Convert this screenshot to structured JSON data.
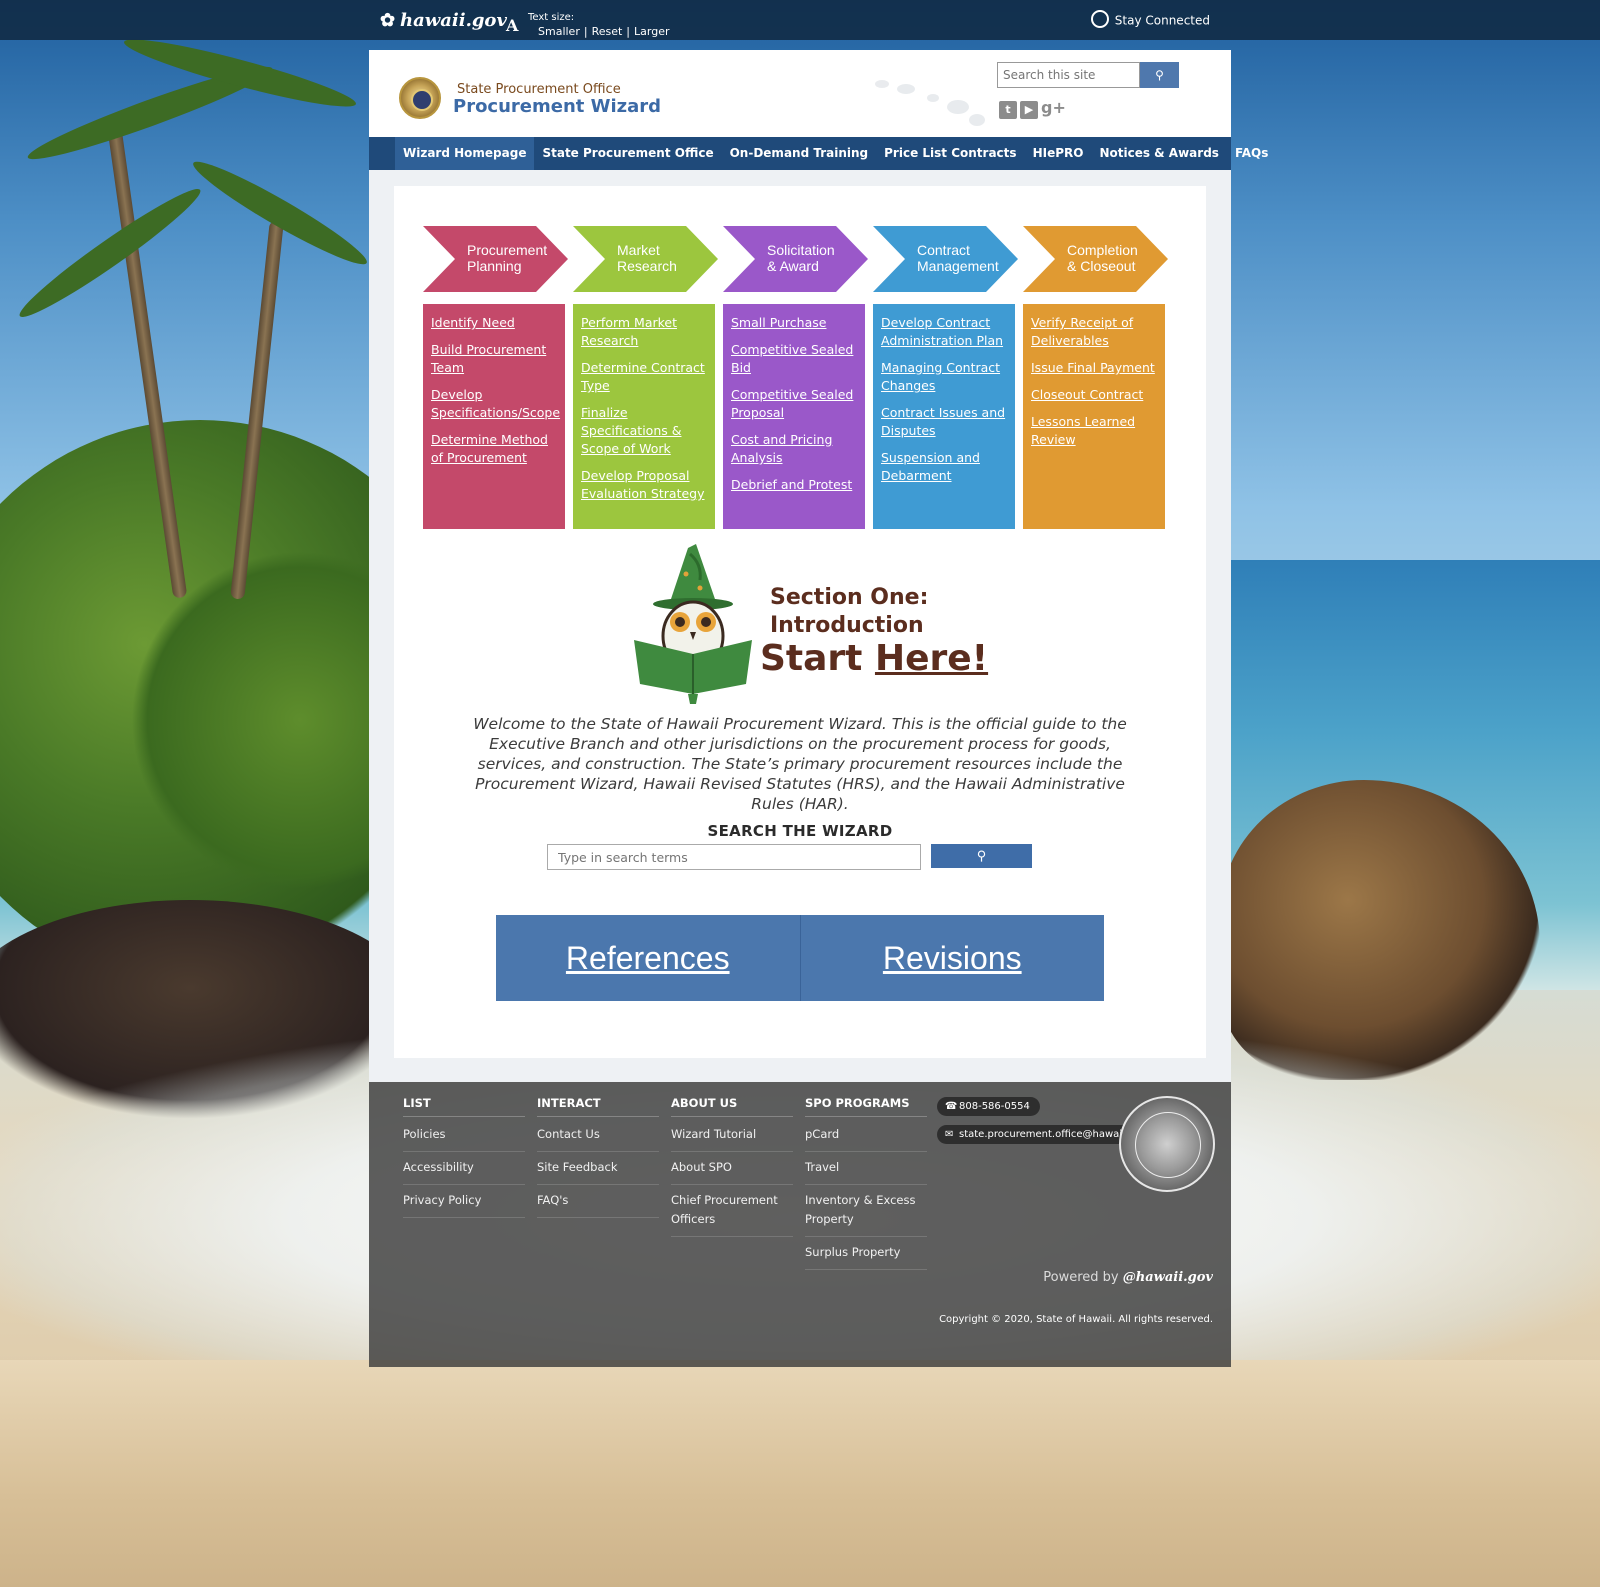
{
  "topbar": {
    "site": "hawaii.gov",
    "text_size_label": "Text size:",
    "text_size_options": [
      "Smaller",
      "Reset",
      "Larger"
    ],
    "stay_connected": "Stay Connected"
  },
  "header": {
    "subtitle": "State Procurement Office",
    "title": "Procurement Wizard",
    "search_placeholder": "Search this site",
    "social": [
      "twitter-icon",
      "youtube-icon",
      "google-plus-icon"
    ]
  },
  "nav": {
    "items": [
      "Wizard Homepage",
      "State Procurement Office",
      "On-Demand Training",
      "Price List Contracts",
      "HIePRO",
      "Notices & Awards",
      "FAQs"
    ],
    "active": "Wizard Homepage"
  },
  "process": [
    {
      "title": [
        "Procurement",
        "Planning"
      ],
      "color": "#c4496a",
      "links": [
        "Identify Need",
        "Build Procurement Team",
        "Develop Specifications/Scope",
        "Determine Method of Procurement"
      ]
    },
    {
      "title": [
        "Market",
        "Research"
      ],
      "color": "#9cc63e",
      "links": [
        "Perform Market Research",
        "Determine Contract Type",
        "Finalize Specifications & Scope of Work",
        "Develop Proposal Evaluation Strategy"
      ]
    },
    {
      "title": [
        "Solicitation",
        "& Award"
      ],
      "color": "#9a58c9",
      "links": [
        "Small Purchase",
        "Competitive Sealed Bid",
        "Competitive Sealed Proposal",
        "Cost and Pricing Analysis",
        "Debrief and Protest"
      ]
    },
    {
      "title": [
        "Contract",
        "Management"
      ],
      "color": "#3f9bd3",
      "links": [
        "Develop Contract Administration Plan",
        "Managing Contract Changes",
        "Contract Issues and Disputes",
        "Suspension and Debarment"
      ]
    },
    {
      "title": [
        "Completion",
        "& Closeout"
      ],
      "color": "#e09a32",
      "links": [
        "Verify Receipt of Deliverables",
        "Issue Final Payment",
        "Closeout Contract",
        "Lessons Learned Review"
      ]
    }
  ],
  "intro": {
    "section_line1": "Section One:",
    "section_line2": "Introduction",
    "start": "Start",
    "here": "Here!",
    "welcome": "Welcome to the State of Hawaii Procurement Wizard. This is the official guide to the Executive Branch and other jurisdictions on the procurement process for goods, services, and construction. The State’s primary procurement resources include the Procurement Wizard, Hawaii Revised Statutes (HRS), and the Hawaii Administrative Rules (HAR)."
  },
  "wizard_search": {
    "title": "SEARCH THE WIZARD",
    "placeholder": "Type in search terms"
  },
  "big_buttons": [
    "References",
    "Revisions"
  ],
  "footer": {
    "columns": [
      {
        "heading": "LIST",
        "links": [
          "Policies",
          "Accessibility",
          "Privacy Policy"
        ]
      },
      {
        "heading": "INTERACT",
        "links": [
          "Contact Us",
          "Site Feedback",
          "FAQ's"
        ]
      },
      {
        "heading": "ABOUT US",
        "links": [
          "Wizard Tutorial",
          "About SPO",
          "Chief Procurement Officers"
        ]
      },
      {
        "heading": "SPO PROGRAMS",
        "links": [
          "pCard",
          "Travel",
          "Inventory & Excess Property",
          "Surplus Property"
        ]
      }
    ],
    "phone": "808-586-0554",
    "email": "state.procurement.office@hawaii.gov",
    "powered_by": "Powered by",
    "powered_brand": "@hawaii.gov",
    "copyright": "Copyright © 2020, State of Hawaii. All rights reserved."
  }
}
